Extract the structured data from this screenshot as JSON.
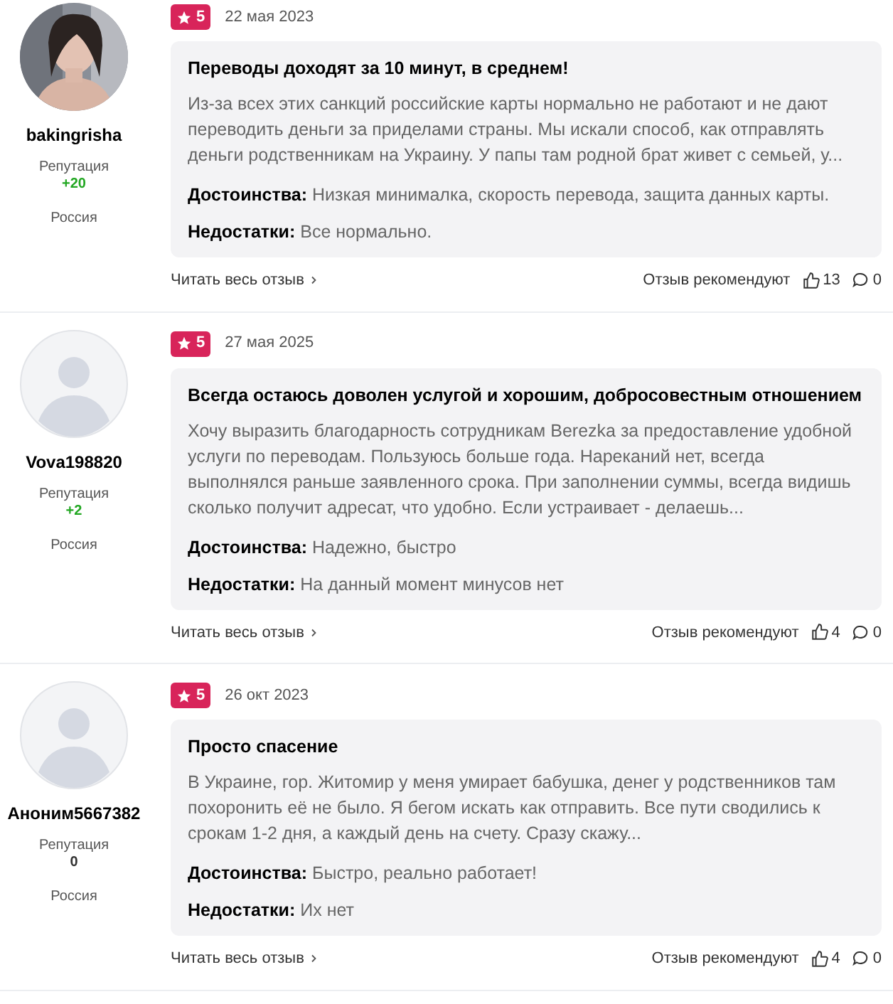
{
  "reviews": [
    {
      "author": {
        "name": "bakingrisha",
        "reputation_label": "Репутация",
        "reputation": "+20",
        "reputation_positive": true,
        "country": "Россия"
      },
      "rating": "5",
      "date": "22 мая 2023",
      "title": "Переводы доходят за 10 минут, в среднем!",
      "body": "Из-за всех этих санкций российские карты нормально не работают и не дают переводить деньги за приделами страны. Мы искали способ, как отправлять деньги родственникам на Украину. У папы там родной брат живет с семьей, у...",
      "pros_label": "Достоинства:",
      "pros": "Низкая минималка, скорость перевода, защита данных карты.",
      "cons_label": "Недостатки:",
      "cons": "Все нормально.",
      "read_more": "Читать весь отзыв",
      "recommend_label": "Отзыв рекомендуют",
      "likes": "13",
      "comments": "0"
    },
    {
      "author": {
        "name": "Vova198820",
        "reputation_label": "Репутация",
        "reputation": "+2",
        "reputation_positive": true,
        "country": "Россия"
      },
      "rating": "5",
      "date": "27 мая 2025",
      "title": "Всегда остаюсь доволен услугой и хорошим, добросовестным отношением",
      "body": "Хочу выразить благодарность сотрудникам Berezka за предоставление удобной услуги по переводам. Пользуюсь больше года. Нареканий нет, всегда выполнялся раньше заявленного срока. При заполнении суммы, всегда видишь сколько получит адресат, что удобно. Если устраивает - делаешь...",
      "pros_label": "Достоинства:",
      "pros": "Надежно, быстро",
      "cons_label": "Недостатки:",
      "cons": "На данный момент минусов нет",
      "read_more": "Читать весь отзыв",
      "recommend_label": "Отзыв рекомендуют",
      "likes": "4",
      "comments": "0"
    },
    {
      "author": {
        "name": "Аноним5667382",
        "reputation_label": "Репутация",
        "reputation": "0",
        "reputation_positive": false,
        "country": "Россия"
      },
      "rating": "5",
      "date": "26 окт 2023",
      "title": "Просто спасение",
      "body": "В Украине, гор. Житомир у меня умирает бабушка, денег у родственников там похоронить её не было. Я бегом искать как отправить. Все пути сводились к срокам 1-2 дня, а каждый день на счету. Сразу скажу...",
      "pros_label": "Достоинства:",
      "pros": "Быстро, реально работает!",
      "cons_label": "Недостатки:",
      "cons": "Их нет",
      "read_more": "Читать весь отзыв",
      "recommend_label": "Отзыв рекомендуют",
      "likes": "4",
      "comments": "0"
    }
  ]
}
